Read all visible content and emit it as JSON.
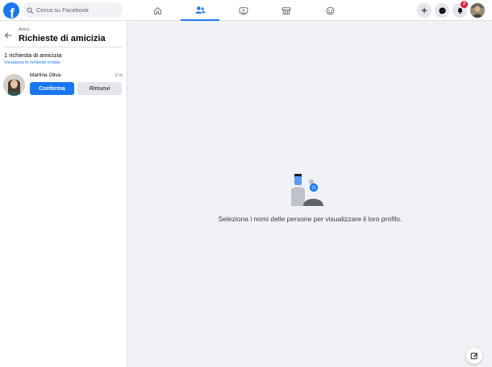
{
  "topbar": {
    "logo_letter": "f",
    "search_placeholder": "Cerca su Facebook",
    "notification_count": "2",
    "icons": [
      "facebook-logo",
      "search-icon",
      "home-icon",
      "friends-icon",
      "watch-icon",
      "marketplace-icon",
      "gaming-icon",
      "plus-icon",
      "messenger-icon",
      "bell-icon"
    ],
    "accent_color": "#1877f2"
  },
  "sidebar": {
    "breadcrumb": "Amici",
    "title": "Richieste di amicizia",
    "request_count": "1 richiesta di amicizia",
    "sent_requests_link": "Visualizza le richieste inviate",
    "requests": [
      {
        "name": "Martina Oliva",
        "time": "2 m",
        "confirm_label": "Conferma",
        "remove_label": "Rimuovi"
      }
    ]
  },
  "main": {
    "empty_message": "Seleziona i nomi delle persone per visualizzare il loro profilo."
  }
}
